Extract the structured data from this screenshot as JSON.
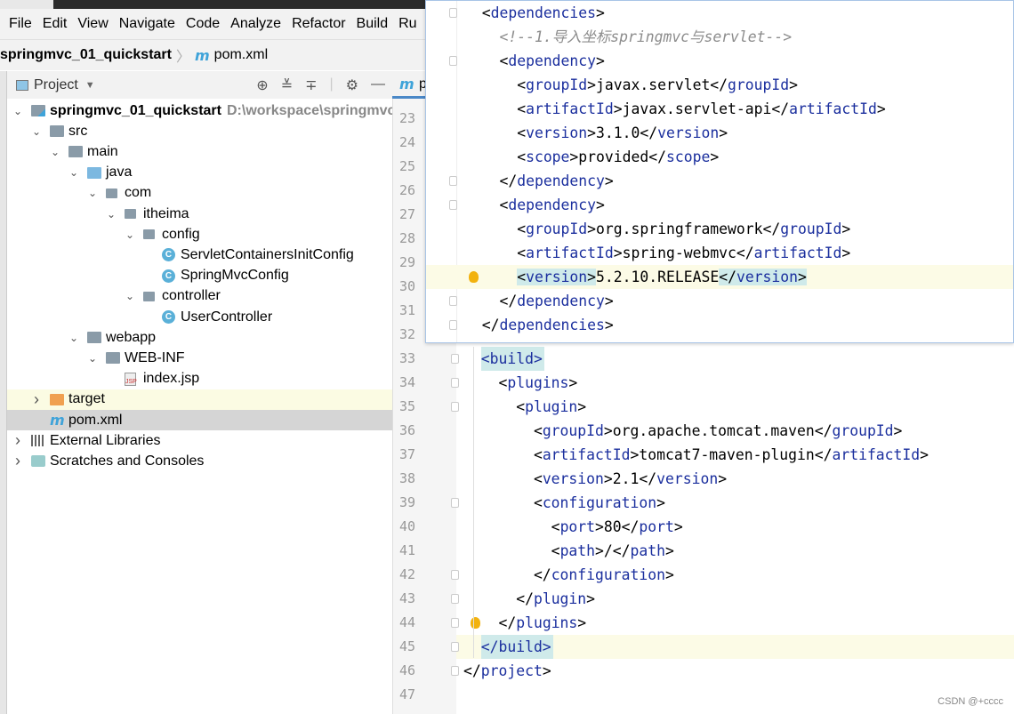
{
  "menu": [
    "File",
    "Edit",
    "View",
    "Navigate",
    "Code",
    "Analyze",
    "Refactor",
    "Build",
    "Ru"
  ],
  "breadcrumb": {
    "project": "springmvc_01_quickstart",
    "file": "pom.xml"
  },
  "project_panel": {
    "title": "Project",
    "tools": [
      "locate-icon",
      "expand-all-icon",
      "collapse-all-icon",
      "gear-icon",
      "minimize-icon"
    ]
  },
  "tree": [
    {
      "label": "springmvc_01_quickstart",
      "path": "D:\\workspace\\springmvc\\s",
      "level": 0,
      "chevron": "down",
      "icon": "module",
      "bold": true
    },
    {
      "label": "src",
      "level": 1,
      "chevron": "down",
      "icon": "folder"
    },
    {
      "label": "main",
      "level": 2,
      "chevron": "down",
      "icon": "folder"
    },
    {
      "label": "java",
      "level": 3,
      "chevron": "down",
      "icon": "folder-blue"
    },
    {
      "label": "com",
      "level": 4,
      "chevron": "down",
      "icon": "package"
    },
    {
      "label": "itheima",
      "level": 5,
      "chevron": "down",
      "icon": "package"
    },
    {
      "label": "config",
      "level": 6,
      "chevron": "down",
      "icon": "package"
    },
    {
      "label": "ServletContainersInitConfig",
      "level": 7,
      "icon": "class"
    },
    {
      "label": "SpringMvcConfig",
      "level": 7,
      "icon": "class"
    },
    {
      "label": "controller",
      "level": 6,
      "chevron": "down",
      "icon": "package"
    },
    {
      "label": "UserController",
      "level": 7,
      "icon": "class"
    },
    {
      "label": "webapp",
      "level": 3,
      "chevron": "down",
      "icon": "folder-web"
    },
    {
      "label": "WEB-INF",
      "level": 4,
      "chevron": "down",
      "icon": "folder"
    },
    {
      "label": "index.jsp",
      "level": 5,
      "icon": "jsp"
    },
    {
      "label": "target",
      "level": 1,
      "chevron": "right",
      "icon": "folder-orange",
      "state": "highlight"
    },
    {
      "label": "pom.xml",
      "level": 1,
      "icon": "maven",
      "state": "selected"
    },
    {
      "label": "External Libraries",
      "level": 0,
      "chevron": "right",
      "icon": "libraries"
    },
    {
      "label": "Scratches and Consoles",
      "level": 0,
      "chevron": "right",
      "icon": "scratches"
    }
  ],
  "editor_tab": {
    "label": "p"
  },
  "editor": {
    "line_numbers": [
      23,
      24,
      25,
      26,
      27,
      28,
      29,
      30,
      31,
      32,
      33,
      34,
      35,
      36,
      37,
      38,
      39,
      40,
      41,
      42,
      43,
      44,
      45,
      46,
      47
    ],
    "lines": [
      {
        "n": 33,
        "text": "  <build>",
        "hl_tags": true
      },
      {
        "n": 34,
        "text": "    <plugins>"
      },
      {
        "n": 35,
        "text": "      <plugin>"
      },
      {
        "n": 36,
        "text": "        <groupId>org.apache.tomcat.maven</groupId>"
      },
      {
        "n": 37,
        "text": "        <artifactId>tomcat7-maven-plugin</artifactId>"
      },
      {
        "n": 38,
        "text": "        <version>2.1</version>"
      },
      {
        "n": 39,
        "text": "        <configuration>"
      },
      {
        "n": 40,
        "text": "          <port>80</port>"
      },
      {
        "n": 41,
        "text": "          <path>/</path>"
      },
      {
        "n": 42,
        "text": "        </configuration>"
      },
      {
        "n": 43,
        "text": "      </plugin>"
      },
      {
        "n": 44,
        "text": "    </plugins>",
        "bulb": true
      },
      {
        "n": 45,
        "text": "  </build>",
        "hl_tags": true,
        "caret": true
      },
      {
        "n": 46,
        "text": "</project>"
      },
      {
        "n": 47,
        "text": ""
      }
    ]
  },
  "popup": {
    "lines": [
      {
        "text": "  <dependencies>"
      },
      {
        "text": "    <!--1.导入坐标springmvc与servlet-->",
        "comment": true
      },
      {
        "text": "    <dependency>"
      },
      {
        "text": "      <groupId>javax.servlet</groupId>"
      },
      {
        "text": "      <artifactId>javax.servlet-api</artifactId>"
      },
      {
        "text": "      <version>3.1.0</version>"
      },
      {
        "text": "      <scope>provided</scope>"
      },
      {
        "text": "    </dependency>"
      },
      {
        "text": "    <dependency>"
      },
      {
        "text": "      <groupId>org.springframework</groupId>"
      },
      {
        "text": "      <artifactId>spring-webmvc</artifactId>"
      },
      {
        "text": "      <version>5.2.10.RELEASE</version>",
        "hl_tags": true,
        "caret": true,
        "bulb": true
      },
      {
        "text": "    </dependency>"
      },
      {
        "text": "  </dependencies>"
      }
    ]
  },
  "watermark": "CSDN @+cccc"
}
